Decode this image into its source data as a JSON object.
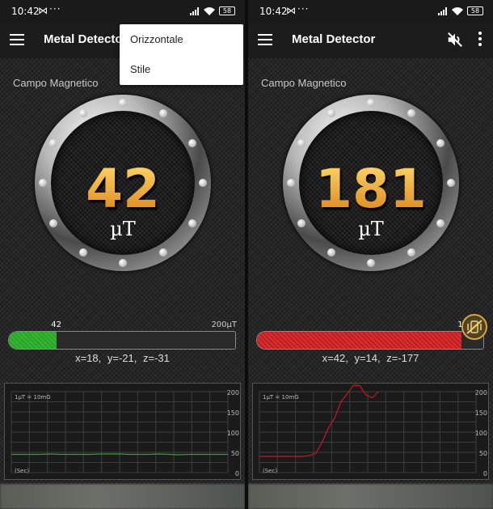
{
  "status": {
    "time": "10:42",
    "mail_icon": "⋈",
    "more": "···",
    "battery": "58"
  },
  "app": {
    "title": "Metal Detector"
  },
  "menu": {
    "items": [
      "Orizzontale",
      "Stile"
    ]
  },
  "screens": [
    {
      "field_label": "Campo Magnetico",
      "value": "42",
      "unit": "µT",
      "bar": {
        "value_label": "42",
        "max_label": "200µT",
        "fraction": 0.21,
        "color": "#21a81f"
      },
      "axes": {
        "x": "x=18,",
        "y": "y=-21,",
        "z": "z=-31"
      }
    },
    {
      "field_label": "Campo Magnetico",
      "value": "181",
      "unit": "µT",
      "bar": {
        "value_label": "181",
        "max_label": "",
        "fraction": 0.905,
        "color": "#c8191a"
      },
      "axes": {
        "x": "x=42,",
        "y": "y=14,",
        "z": "z=-177"
      }
    }
  ],
  "chart_data": [
    {
      "type": "line",
      "annotation": "1µT = 10mG",
      "xlabel": "(Sec)",
      "ylim": [
        0,
        200
      ],
      "yticks": [
        "200",
        "150",
        "100",
        "50",
        "0"
      ],
      "series": [
        {
          "color": "#24a824",
          "y": [
            45,
            45,
            45,
            45,
            46,
            45,
            45,
            45,
            45,
            46,
            46,
            46,
            45,
            45,
            45,
            46,
            45,
            44,
            45,
            45,
            45,
            45,
            45
          ]
        }
      ]
    },
    {
      "type": "line",
      "annotation": "1µT = 10mG",
      "xlabel": "(Sec)",
      "ylim": [
        0,
        200
      ],
      "yticks": [
        "200",
        "150",
        "100",
        "50",
        "0"
      ],
      "series": [
        {
          "color": "#c8191a",
          "y": [
            40,
            40,
            40,
            40,
            40,
            40,
            40,
            40,
            42,
            48,
            75,
            110,
            135,
            175,
            195,
            220,
            215,
            192,
            185,
            200
          ]
        }
      ]
    }
  ]
}
